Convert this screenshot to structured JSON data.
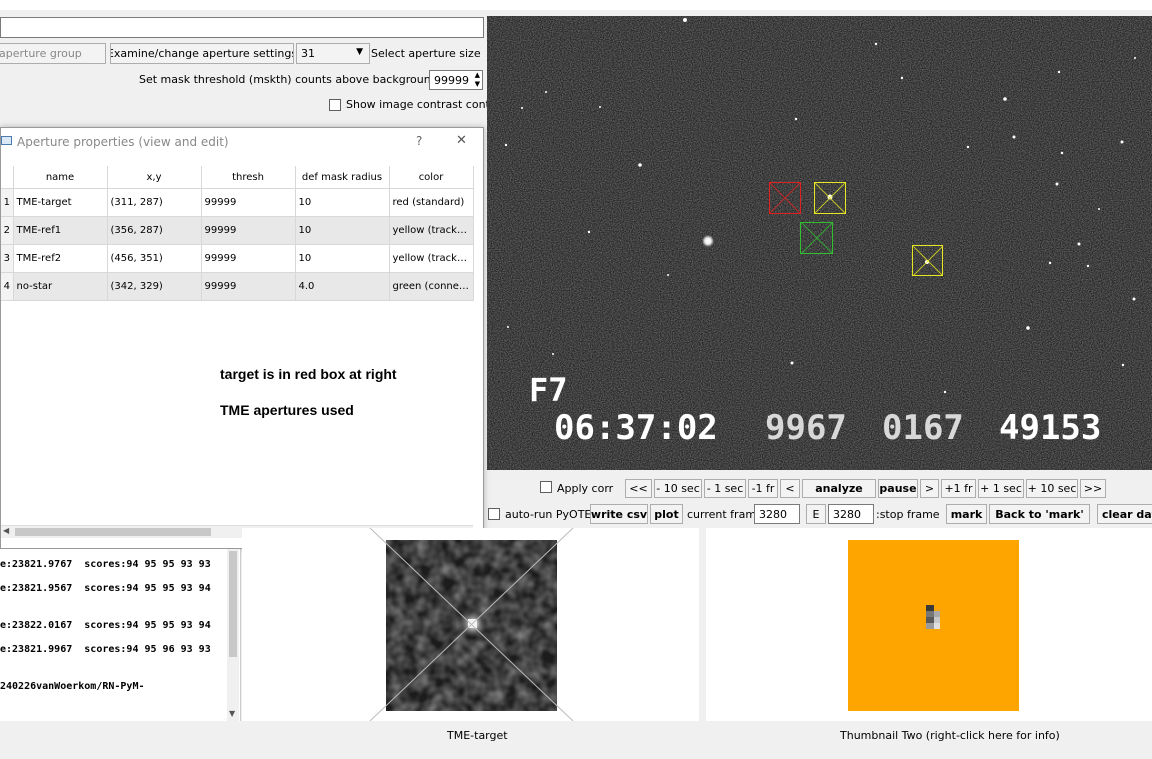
{
  "top": {
    "add_aperture_group_label": "aperture group",
    "examine_button_label": "Examine/change aperture settings",
    "aperture_size_value": "31",
    "aperture_size_label": "Select aperture size",
    "mask_threshold_label": "Set mask threshold (mskth) counts above background (bkavg)",
    "mask_threshold_value": "99999",
    "contrast_checkbox_label": "Show image contrast control"
  },
  "dialog": {
    "title": "Aperture properties (view and edit)",
    "help_glyph": "?",
    "close_glyph": "✕",
    "columns": [
      "name",
      "x,y",
      "thresh",
      "def mask radius",
      "color"
    ],
    "rows": [
      {
        "num": "1",
        "name": "TME-target",
        "xy": "(311, 287)",
        "thresh": "99999",
        "radius": "10",
        "color": "red (standard)"
      },
      {
        "num": "2",
        "name": "TME-ref1",
        "xy": "(356, 287)",
        "thresh": "99999",
        "radius": "10",
        "color": "yellow (tracking ..."
      },
      {
        "num": "3",
        "name": "TME-ref2",
        "xy": "(456, 351)",
        "thresh": "99999",
        "radius": "10",
        "color": "yellow (tracking ..."
      },
      {
        "num": "4",
        "name": "no-star",
        "xy": "(342, 329)",
        "thresh": "99999",
        "radius": "4.0",
        "color": "green (connect t..."
      }
    ],
    "note1": "target is in red box at right",
    "note2": "TME apertures used"
  },
  "log": {
    "lines": [
      "e:23821.9767  scores:94 95 95 93 93",
      "e:23821.9567  scores:94 95 95 93 94",
      "e:23822.0167  scores:94 95 95 93 94",
      "e:23821.9967  scores:94 95 96 93 93",
      "240226vanWoerkom/RN-PyM-"
    ]
  },
  "video": {
    "field_label": "F7",
    "timestamp": "06:37:02",
    "ms1": "9967",
    "ms2": "0167",
    "frame_num": "49153"
  },
  "controls": {
    "apply_corr_label": "Apply corr",
    "nav": [
      "<<",
      "- 10 sec",
      "- 1 sec",
      "-1 fr",
      "<",
      "analyze",
      "pause",
      ">",
      "+1 fr",
      "+ 1 sec",
      "+ 10 sec",
      ">>"
    ],
    "auto_run_label": "auto-run PyOTE",
    "write_csv_label": "write csv",
    "plot_label": "plot",
    "current_frame_label": "current frame:",
    "current_frame_value": "3280",
    "e_label": "E",
    "stop_frame_value": "3280",
    "stop_frame_label": ":stop frame",
    "mark_label": "mark",
    "back_to_mark_label": "Back to 'mark'",
    "clear_data_label": "clear data"
  },
  "thumbnails": {
    "one_caption": "TME-target",
    "two_caption": "Thumbnail Two (right-click here for info)"
  },
  "colors": {
    "orange": "#ffa500",
    "red_aperture": "#e02020",
    "yellow_aperture": "#e8e820",
    "green_aperture": "#30c030"
  }
}
